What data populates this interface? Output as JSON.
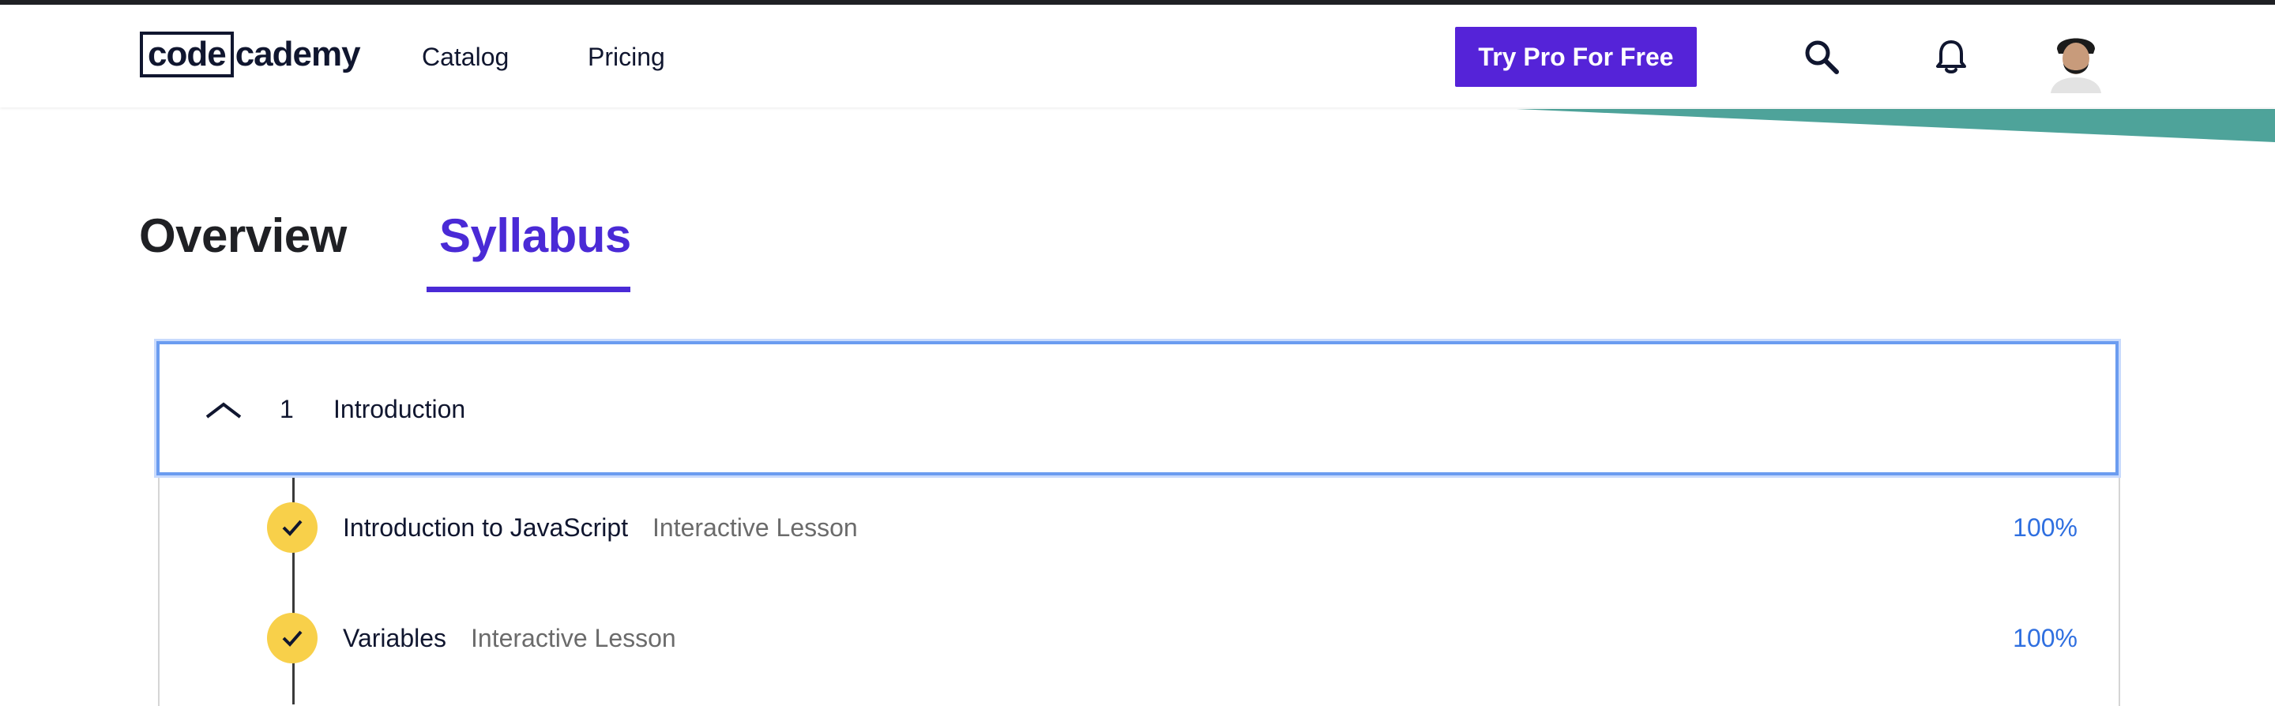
{
  "header": {
    "logo_part1": "code",
    "logo_part2": "cademy",
    "nav": [
      {
        "label": "Catalog"
      },
      {
        "label": "Pricing"
      }
    ],
    "cta_label": "Try Pro For Free",
    "icons": {
      "search": "search-icon",
      "notifications": "bell-icon",
      "avatar": "user-avatar"
    }
  },
  "tabs": [
    {
      "label": "Overview",
      "active": false
    },
    {
      "label": "Syllabus",
      "active": true
    }
  ],
  "syllabus": {
    "module": {
      "number": "1",
      "title": "Introduction",
      "expanded": true
    },
    "lessons": [
      {
        "title": "Introduction to JavaScript",
        "type": "Interactive Lesson",
        "progress": "100%",
        "completed": true
      },
      {
        "title": "Variables",
        "type": "Interactive Lesson",
        "progress": "100%",
        "completed": true
      }
    ]
  },
  "colors": {
    "accent_purple": "#5523d8",
    "tab_active": "#4a2ad6",
    "teal_band": "#4ea39a",
    "check_yellow": "#f8d04a",
    "progress_blue": "#2f6fe0",
    "focus_ring": "#6b9cf0"
  }
}
